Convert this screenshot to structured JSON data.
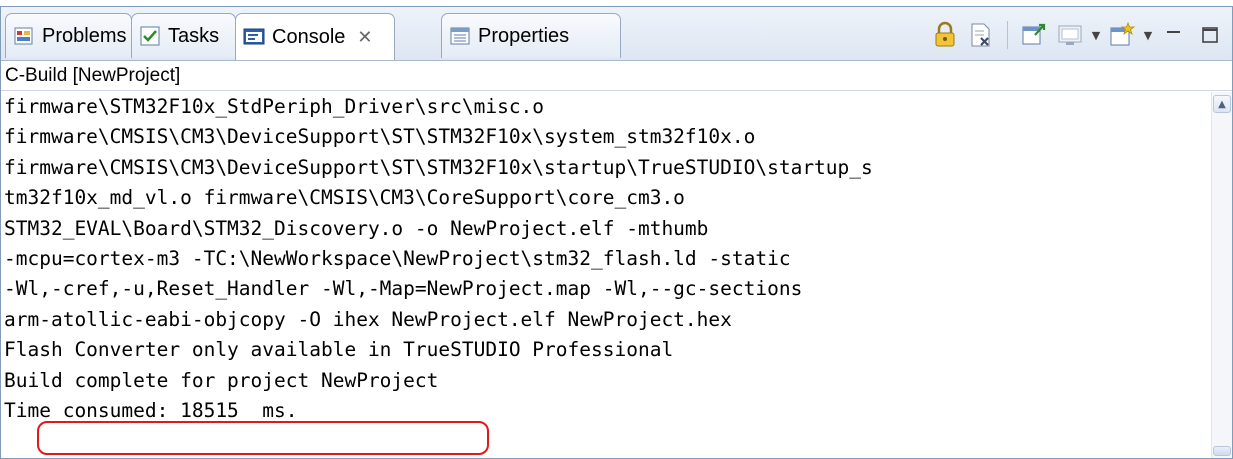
{
  "tabs": [
    {
      "label": "Problems",
      "icon": "problems-icon",
      "active": false
    },
    {
      "label": "Tasks",
      "icon": "tasks-icon",
      "active": false
    },
    {
      "label": "Console",
      "icon": "console-icon",
      "active": true,
      "close": "✕"
    },
    {
      "label": "Properties",
      "icon": "properties-icon",
      "active": false
    }
  ],
  "toolbar": {
    "buttons": [
      "scroll-lock-icon",
      "clear-console-icon",
      "pin-console-icon",
      "display-selected-console-icon",
      "open-console-icon"
    ],
    "minimize": "minimize-icon",
    "maximize": "maximize-icon"
  },
  "console": {
    "title": "C-Build [NewProject]",
    "lines": [
      "firmware\\STM32F10x_StdPeriph_Driver\\src\\misc.o",
      "firmware\\CMSIS\\CM3\\DeviceSupport\\ST\\STM32F10x\\system_stm32f10x.o",
      "firmware\\CMSIS\\CM3\\DeviceSupport\\ST\\STM32F10x\\startup\\TrueSTUDIO\\startup_s",
      "tm32f10x_md_vl.o firmware\\CMSIS\\CM3\\CoreSupport\\core_cm3.o",
      "STM32_EVAL\\Board\\STM32_Discovery.o -o NewProject.elf -mthumb",
      "-mcpu=cortex-m3 -TC:\\NewWorkspace\\NewProject\\stm32_flash.ld -static",
      "-Wl,-cref,-u,Reset_Handler -Wl,-Map=NewProject.map -Wl,--gc-sections",
      "arm-atollic-eabi-objcopy -O ihex NewProject.elf NewProject.hex",
      "Flash Converter only available in TrueSTUDIO Professional",
      "Build complete for project NewProject",
      "Time consumed: 18515  ms."
    ]
  },
  "colors": {
    "highlight": "#e01a1a",
    "tab_border": "#98a9c2"
  }
}
